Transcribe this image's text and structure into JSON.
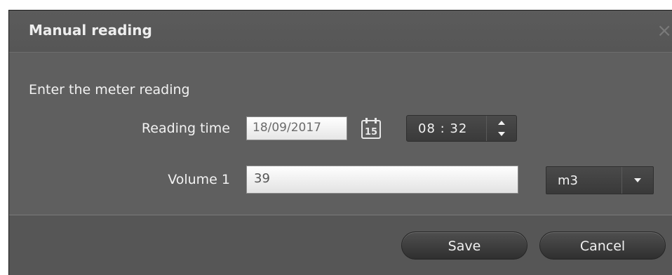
{
  "dialog": {
    "title": "Manual reading",
    "close_glyph": "×"
  },
  "form": {
    "intro": "Enter the meter reading",
    "reading_time_label": "Reading time",
    "date_value": "18/09/2017",
    "calendar_day": "15",
    "time_value": "08 : 32",
    "volume_label": "Volume 1",
    "volume_value": "39",
    "unit_value": "m3"
  },
  "buttons": {
    "save_label": "Save",
    "cancel_label": "Cancel"
  },
  "icons": {
    "calendar": "calendar-icon",
    "spin_up": "chevron-up-icon",
    "spin_down": "chevron-down-icon",
    "dropdown": "caret-down-icon"
  },
  "colors": {
    "dialog_bg": "#5f5f5f",
    "button_bg": "#3a3a3a",
    "text": "#f2f2f2"
  }
}
